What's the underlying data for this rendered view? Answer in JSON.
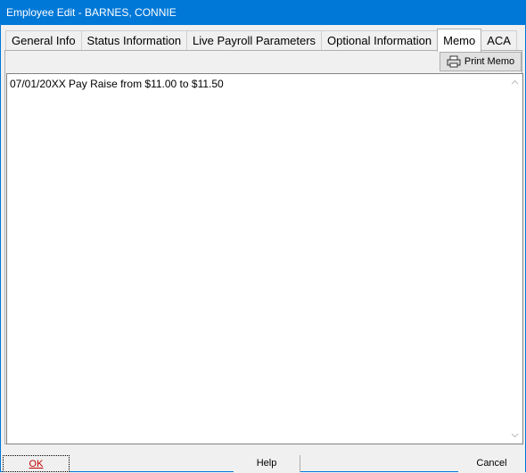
{
  "window": {
    "title": "Employee Edit - BARNES, CONNIE"
  },
  "tabs": [
    {
      "label": "General Info",
      "active": false
    },
    {
      "label": "Status Information",
      "active": false
    },
    {
      "label": "Live Payroll Parameters",
      "active": false
    },
    {
      "label": "Optional Information",
      "active": false
    },
    {
      "label": "Memo",
      "active": true
    },
    {
      "label": "ACA",
      "active": false
    }
  ],
  "toolbar": {
    "print_memo_label": "Print Memo",
    "print_icon": "printer-icon"
  },
  "memo": {
    "text": "07/01/20XX Pay Raise from $11.00 to $11.50"
  },
  "buttons": {
    "ok_label": "OK",
    "help_label": "Help",
    "cancel_label": "Cancel"
  },
  "colors": {
    "title_bar": "#0078d7",
    "ok_text": "#c00000"
  }
}
